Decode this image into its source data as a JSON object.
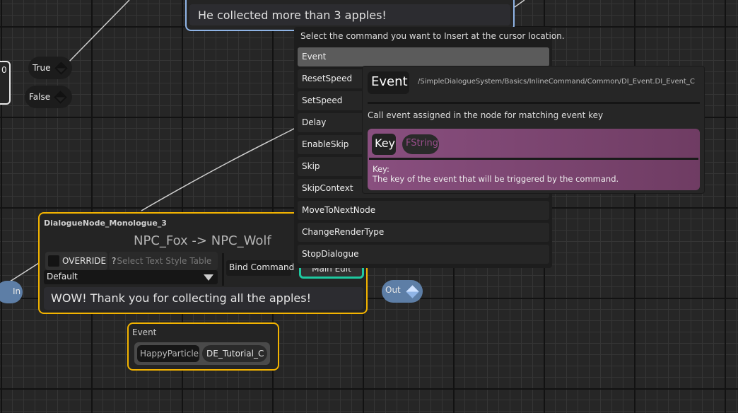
{
  "top_node": {
    "text": "He collected more than 3 apples!"
  },
  "left_node": {
    "label": "0"
  },
  "branch_pins": {
    "true_label": "True",
    "false_label": "False"
  },
  "main_node": {
    "title": "DialogueNode_Monologue_3",
    "speaker": "NPC_Fox -> NPC_Wolf",
    "override_label": "OVERRIDE",
    "style_table_placeholder": "Select Text Style Table",
    "style_dropdown_value": "Default",
    "bind_command_label": "Bind Command",
    "main_edit_label": "Main Edit",
    "dialogue_text": "WOW! Thank you for collecting all the apples!",
    "in_pin": "In",
    "out_pin": "Out"
  },
  "event_node": {
    "title": "Event",
    "key": "HappyParticle",
    "class": "DE_Tutorial_C"
  },
  "command_menu": {
    "header": "Select the command you want to Insert at the cursor location.",
    "items": [
      "Event",
      "ResetSpeed",
      "SetSpeed",
      "Delay",
      "EnableSkip",
      "Skip",
      "SkipContext",
      "MoveToNextNode",
      "ChangeRenderType",
      "StopDialogue"
    ],
    "selected": "Event"
  },
  "tooltip": {
    "name": "Event",
    "path": "/SimpleDialogueSystem/Basics/InlineCommand/Common/DI_Event.DI_Event_C",
    "description": "Call event assigned in the node for matching event key",
    "param_name": "Key",
    "param_type": "FString",
    "param_desc_title": "Key:",
    "param_desc": "The key of the event that will be triggered by the command."
  },
  "colors": {
    "selected_node_border": "#f4b400",
    "top_node_border": "#8fb4e6",
    "main_edit_border": "#1ec9a0",
    "param_box": "#894f7f",
    "exec_pin": "#5d7ea6"
  }
}
